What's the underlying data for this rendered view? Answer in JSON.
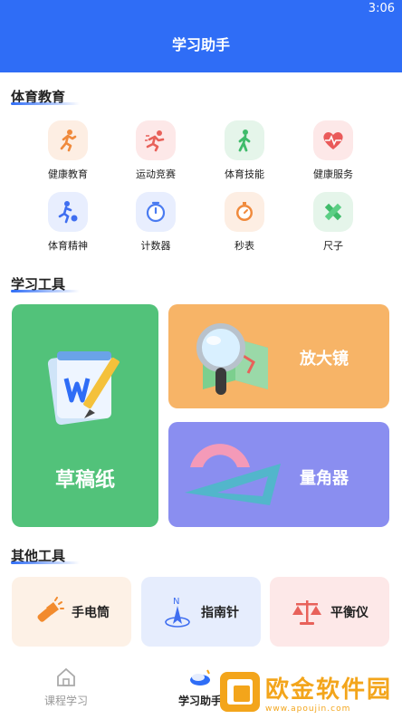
{
  "status": {
    "time": "3:06"
  },
  "app": {
    "title": "学习助手"
  },
  "sports": {
    "title": "体育教育",
    "items": [
      {
        "label": "健康教育",
        "icon": "running-icon",
        "bg": "#fdeee3",
        "fg": "#f08a3c"
      },
      {
        "label": "运动竞赛",
        "icon": "sprint-icon",
        "bg": "#fde8e8",
        "fg": "#e8615a"
      },
      {
        "label": "体育技能",
        "icon": "walking-icon",
        "bg": "#e5f5ea",
        "fg": "#3fbb6a"
      },
      {
        "label": "健康服务",
        "icon": "heart-pulse-icon",
        "bg": "#fde8e8",
        "fg": "#ea5a5a"
      },
      {
        "label": "体育精神",
        "icon": "soccer-icon",
        "bg": "#e8eefe",
        "fg": "#3f6ef0"
      },
      {
        "label": "计数器",
        "icon": "timer-icon",
        "bg": "#e8eefe",
        "fg": "#4a7bf1"
      },
      {
        "label": "秒表",
        "icon": "stopwatch-icon",
        "bg": "#fdeee3",
        "fg": "#f08a3c"
      },
      {
        "label": "尺子",
        "icon": "ruler-pencil-icon",
        "bg": "#e5f5ea",
        "fg": "#3fbb6a"
      }
    ]
  },
  "study": {
    "title": "学习工具",
    "draft": "草稿纸",
    "magnifier": "放大镜",
    "protractor": "量角器"
  },
  "other": {
    "title": "其他工具",
    "items": [
      {
        "label": "手电筒",
        "icon": "flashlight-icon",
        "bg": "#fdf1e6",
        "fg": "#f28b2e"
      },
      {
        "label": "指南针",
        "icon": "compass-icon",
        "bg": "#e6edfd",
        "fg": "#3f6ef0"
      },
      {
        "label": "平衡仪",
        "icon": "balance-scale-icon",
        "bg": "#fde8e8",
        "fg": "#e8615a"
      }
    ]
  },
  "tabs": [
    {
      "label": "课程学习",
      "icon": "home-icon",
      "active": false
    },
    {
      "label": "学习助手",
      "icon": "assistant-icon",
      "active": true
    }
  ],
  "watermark": {
    "main": "欧金软件园",
    "sub": "www.apoujin.com"
  },
  "colors": {
    "primary": "#2f6df6",
    "green": "#52c27a",
    "orange": "#f7b467",
    "purple": "#8a8ef0"
  }
}
